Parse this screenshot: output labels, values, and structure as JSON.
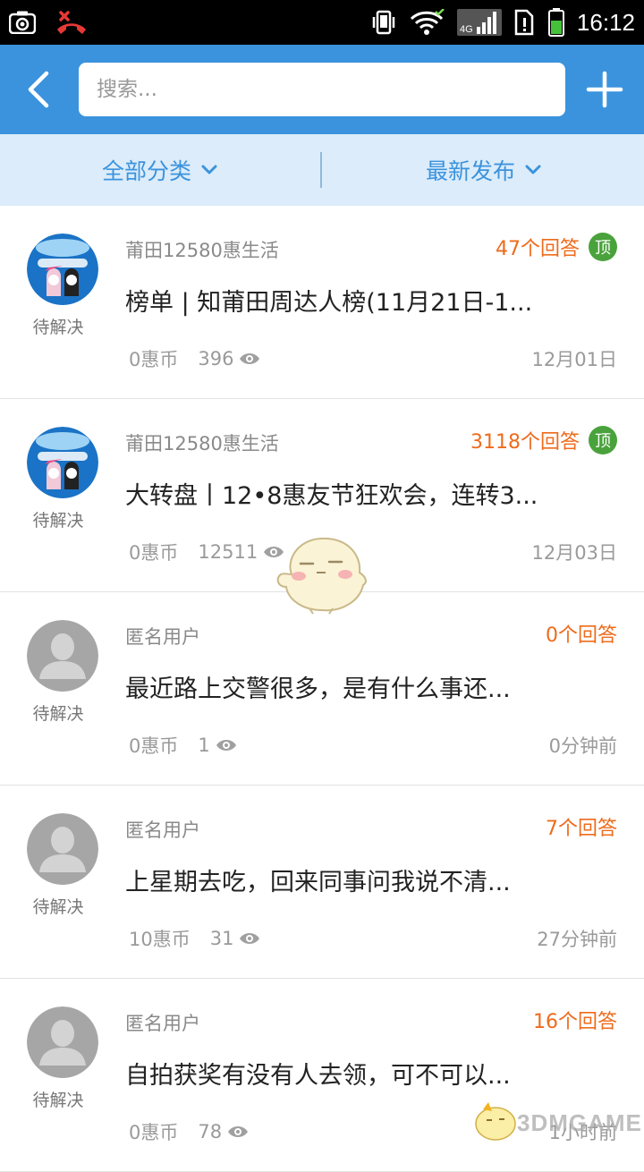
{
  "status_bar": {
    "time": "16:12",
    "network": "4G",
    "icons": [
      "screenshot-icon",
      "missed-call-icon",
      "vibrate-icon",
      "wifi-icon",
      "signal-icon",
      "sim-alert-icon",
      "battery-icon"
    ]
  },
  "header": {
    "search_placeholder": "搜索...",
    "back_icon": "chevron-left-icon",
    "add_icon": "plus-icon",
    "bg_color": "#3b93dd"
  },
  "filters": {
    "category": "全部分类",
    "sort": "最新发布"
  },
  "questions": [
    {
      "author": "莆田12580惠生活",
      "answers": "47个回答",
      "pinned": true,
      "pinned_label": "顶",
      "title": "榜单 | 知莆田周达人榜(11月21日-1...",
      "coins": "0惠币",
      "views": "396",
      "time": "12月01日",
      "status": "待解决",
      "avatar": "brand-avatar"
    },
    {
      "author": "莆田12580惠生活",
      "answers": "3118个回答",
      "pinned": true,
      "pinned_label": "顶",
      "title": "大转盘丨12•8惠友节狂欢会，连转3...",
      "coins": "0惠币",
      "views": "12511",
      "time": "12月03日",
      "status": "待解决",
      "avatar": "brand-avatar"
    },
    {
      "author": "匿名用户",
      "answers": "0个回答",
      "pinned": false,
      "pinned_label": "",
      "title": "最近路上交警很多，是有什么事还...",
      "coins": "0惠币",
      "views": "1",
      "time": "0分钟前",
      "status": "待解决",
      "avatar": "anonymous-avatar"
    },
    {
      "author": "匿名用户",
      "answers": "7个回答",
      "pinned": false,
      "pinned_label": "",
      "title": "上星期去吃，回来同事问我说不清...",
      "coins": "10惠币",
      "views": "31",
      "time": "27分钟前",
      "status": "待解决",
      "avatar": "anonymous-avatar"
    },
    {
      "author": "匿名用户",
      "answers": "16个回答",
      "pinned": false,
      "pinned_label": "",
      "title": "自拍获奖有没有人去领，可不可以...",
      "coins": "0惠币",
      "views": "78",
      "time": "1小时前",
      "status": "待解决",
      "avatar": "anonymous-avatar"
    }
  ],
  "colors": {
    "accent": "#3b93dd",
    "filter_bg": "#dcecfa",
    "answers": "#ee6b1c",
    "pinned_badge": "#4aa23c"
  },
  "watermark": {
    "text": "3DMGAME"
  }
}
